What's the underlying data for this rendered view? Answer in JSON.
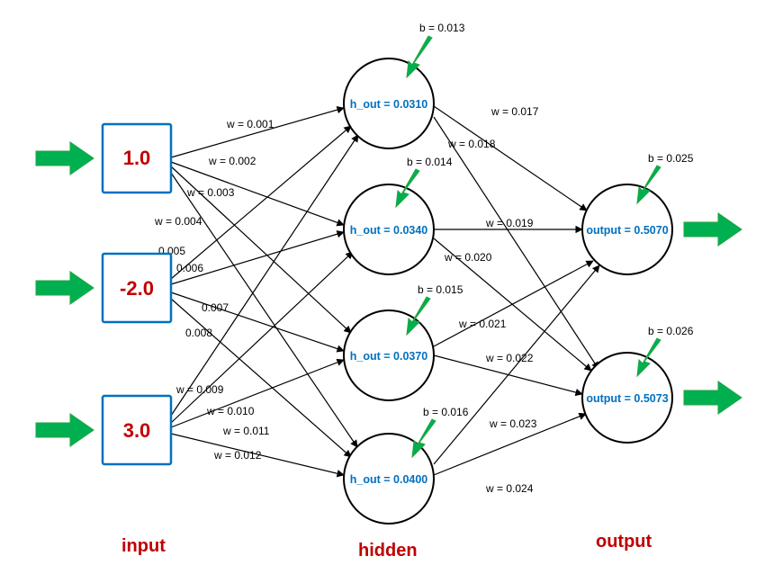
{
  "labels": {
    "input": "input",
    "hidden": "hidden",
    "output": "output"
  },
  "inputs": {
    "i1": "1.0",
    "i2": "-2.0",
    "i3": "3.0"
  },
  "hidden": {
    "h1_text": "h_out = 0.0310",
    "h2_text": "h_out = 0.0340",
    "h3_text": "h_out = 0.0370",
    "h4_text": "h_out = 0.0400"
  },
  "outputs": {
    "o1_text": "output = 0.5070",
    "o2_text": "output = 0.5073"
  },
  "biases": {
    "h1": "b = 0.013",
    "h2": "b = 0.014",
    "h3": "b = 0.015",
    "h4": "b = 0.016",
    "o1": "b = 0.025",
    "o2": "b = 0.026"
  },
  "weights_ih": {
    "i1h1": "w = 0.001",
    "i1h2": "w = 0.002",
    "i1h3": "w = 0.003",
    "i1h4": "w = 0.004",
    "i2h1": "    0.005",
    "i2h2": "          0.006",
    "i2h3": "0.007",
    "i2h4": "0.008",
    "i3h1": "w = 0.009",
    "i3h2": "w = 0.010",
    "i3h3": "w = 0.011",
    "i3h4": "w = 0.012"
  },
  "weights_ho": {
    "h1o1": "w = 0.017",
    "h1o2": "w = 0.018",
    "h2o1": "w = 0.019",
    "h2o2": "w = 0.020",
    "h3o1": "w = 0.021",
    "h3o2": "w = 0.022",
    "h4o1": "w = 0.023",
    "h4o2": "w = 0.024"
  },
  "chart_data": {
    "type": "diagram",
    "network": {
      "layers": [
        {
          "name": "input",
          "nodes": [
            1.0,
            -2.0,
            3.0
          ]
        },
        {
          "name": "hidden",
          "nodes": [
            0.031,
            0.034,
            0.037,
            0.04
          ],
          "biases": [
            0.013,
            0.014,
            0.015,
            0.016
          ]
        },
        {
          "name": "output",
          "nodes": [
            0.507,
            0.5073
          ],
          "biases": [
            0.025,
            0.026
          ]
        }
      ],
      "weights_input_hidden": [
        [
          0.001,
          0.002,
          0.003,
          0.004
        ],
        [
          0.005,
          0.006,
          0.007,
          0.008
        ],
        [
          0.009,
          0.01,
          0.011,
          0.012
        ]
      ],
      "weights_hidden_output": [
        [
          0.017,
          0.018
        ],
        [
          0.019,
          0.02
        ],
        [
          0.021,
          0.022
        ],
        [
          0.023,
          0.024
        ]
      ]
    }
  }
}
